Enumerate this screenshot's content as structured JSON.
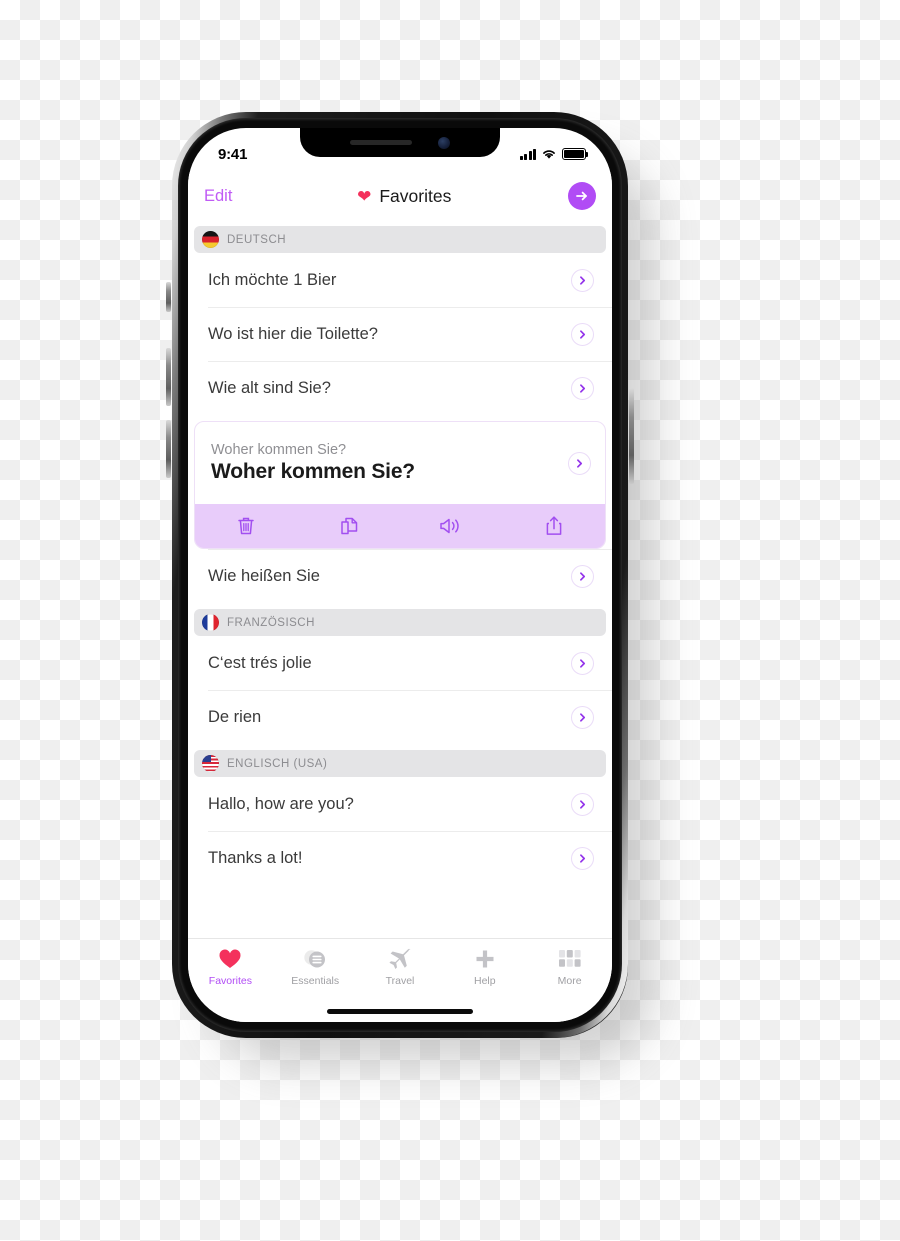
{
  "status_bar": {
    "time": "9:41",
    "signal_icon": "cellular-signal-icon",
    "wifi_icon": "wifi-icon",
    "battery_icon": "battery-icon"
  },
  "nav_bar": {
    "edit_label": "Edit",
    "title": "Favorites",
    "heart_icon": "heart-icon",
    "go_icon": "arrow-right-icon",
    "accent_color": "#b14cf5",
    "heart_color": "#f4315c"
  },
  "sections": [
    {
      "flag": "flag-germany",
      "label": "DEUTSCH",
      "rows": [
        {
          "text": "Ich möchte 1 Bier",
          "expanded": false
        },
        {
          "text": "Wo ist hier die Toilette?",
          "expanded": false
        },
        {
          "text": "Wie alt sind Sie?",
          "expanded": false
        },
        {
          "text": "Woher kommen Sie?",
          "expanded": true,
          "sub_text": "Woher kommen Sie?",
          "title_text": "Woher kommen Sie?",
          "actions": [
            {
              "icon": "trash-icon",
              "name": "delete-action"
            },
            {
              "icon": "copy-icon",
              "name": "copy-action"
            },
            {
              "icon": "speaker-icon",
              "name": "speak-action"
            },
            {
              "icon": "share-icon",
              "name": "share-action"
            }
          ]
        },
        {
          "text": "Wie heißen Sie",
          "expanded": false
        }
      ]
    },
    {
      "flag": "flag-france",
      "label": "FRANZÖSISCH",
      "rows": [
        {
          "text": "C‘est trés jolie",
          "expanded": false
        },
        {
          "text": "De rien",
          "expanded": false
        }
      ]
    },
    {
      "flag": "flag-usa",
      "label": "ENGLISCH (USA)",
      "rows": [
        {
          "text": "Hallo, how are you?",
          "expanded": false
        },
        {
          "text": "Thanks a lot!",
          "expanded": false
        }
      ]
    }
  ],
  "tab_bar": {
    "tabs": [
      {
        "label": "Favorites",
        "icon": "heart-icon",
        "active": true
      },
      {
        "label": "Essentials",
        "icon": "list-circle-icon",
        "active": false
      },
      {
        "label": "Travel",
        "icon": "airplane-icon",
        "active": false
      },
      {
        "label": "Help",
        "icon": "plus-icon",
        "active": false
      },
      {
        "label": "More",
        "icon": "grid-icon",
        "active": false
      }
    ]
  }
}
